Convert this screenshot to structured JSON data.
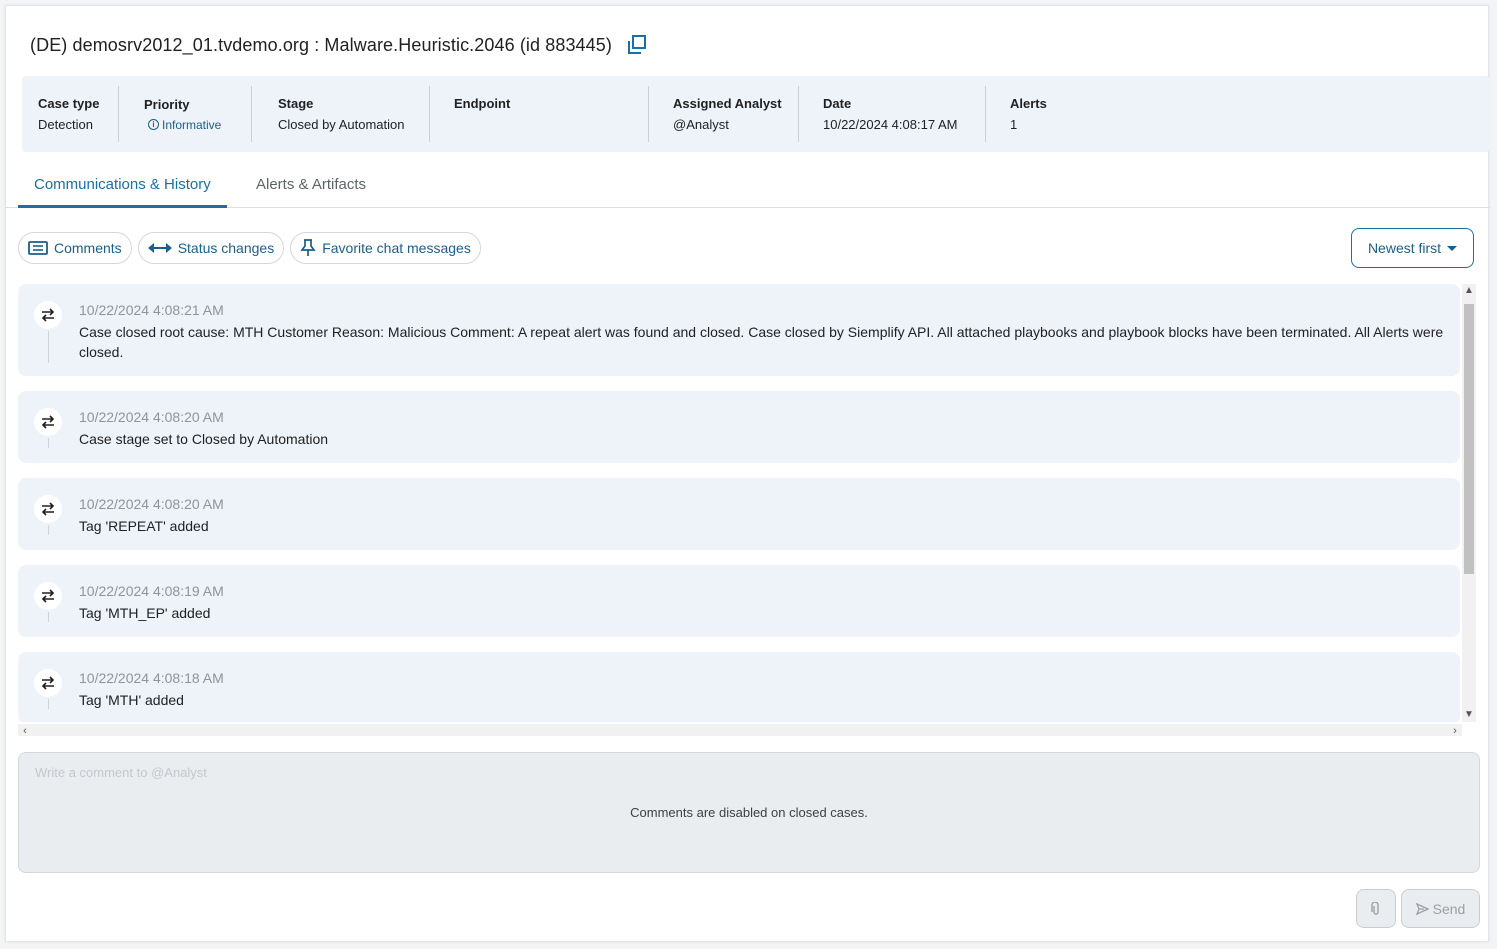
{
  "case": {
    "title": "(DE) demosrv2012_01.tvdemo.org : Malware.Heuristic.2046 (id 883445)"
  },
  "info_bar": {
    "case_type": {
      "label": "Case type",
      "value": "Detection"
    },
    "priority": {
      "label": "Priority",
      "value": "Informative",
      "icon": "info-circle-icon"
    },
    "stage": {
      "label": "Stage",
      "value": "Closed by Automation"
    },
    "endpoint": {
      "label": "Endpoint",
      "value": ""
    },
    "assigned_analyst": {
      "label": "Assigned Analyst",
      "value": "@Analyst"
    },
    "date": {
      "label": "Date",
      "value": "10/22/2024 4:08:17 AM"
    },
    "alerts": {
      "label": "Alerts",
      "value": "1"
    }
  },
  "tabs": [
    {
      "label": "Communications & History",
      "active": true
    },
    {
      "label": "Alerts & Artifacts",
      "active": false
    }
  ],
  "filters": [
    {
      "label": "Comments",
      "icon": "comment-icon"
    },
    {
      "label": "Status changes",
      "icon": "double-arrow-icon"
    },
    {
      "label": "Favorite chat messages",
      "icon": "pin-icon"
    }
  ],
  "sort": {
    "label": "Newest first"
  },
  "events": [
    {
      "timestamp": "10/22/2024 4:08:21 AM",
      "message": "Case closed root cause: MTH Customer Reason: Malicious Comment: A repeat alert was found and closed. Case closed by Siemplify API. All attached playbooks and playbook blocks have been terminated. All Alerts were closed."
    },
    {
      "timestamp": "10/22/2024 4:08:20 AM",
      "message": "Case stage set to Closed by Automation"
    },
    {
      "timestamp": "10/22/2024 4:08:20 AM",
      "message": "Tag 'REPEAT' added"
    },
    {
      "timestamp": "10/22/2024 4:08:19 AM",
      "message": "Tag 'MTH_EP' added"
    },
    {
      "timestamp": "10/22/2024 4:08:18 AM",
      "message": "Tag 'MTH' added"
    }
  ],
  "composer": {
    "placeholder": "Write a comment to @Analyst",
    "disabled_message": "Comments are disabled on closed cases."
  },
  "actions": {
    "send_label": "Send"
  },
  "colors": {
    "accent": "#1a6fa6",
    "card_bg": "#eef3f9",
    "muted_text": "#8d949c"
  }
}
